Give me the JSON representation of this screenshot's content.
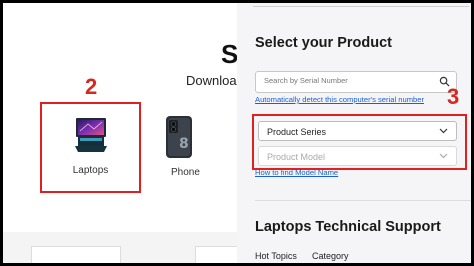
{
  "left": {
    "partial_heading": "S",
    "download_text": "Download",
    "step_marker": "2",
    "products": [
      {
        "label": "Laptops",
        "icon": "laptop-icon"
      },
      {
        "label": "Phone",
        "icon": "phone-icon"
      }
    ]
  },
  "right": {
    "title": "Select your Product",
    "search": {
      "placeholder": "Search by Serial Number"
    },
    "detect_link": "Automatically detect this computer's serial number",
    "step_marker": "3",
    "product_series": {
      "value": "Product Series"
    },
    "product_model": {
      "value": "Product Model"
    },
    "howto_link": "How to find Model Name",
    "support_title": "Laptops Technical Support",
    "tabs": [
      "Hot Topics",
      "Category"
    ]
  },
  "colors": {
    "accent_red": "#e02020",
    "link_blue": "#1a5fd8"
  }
}
